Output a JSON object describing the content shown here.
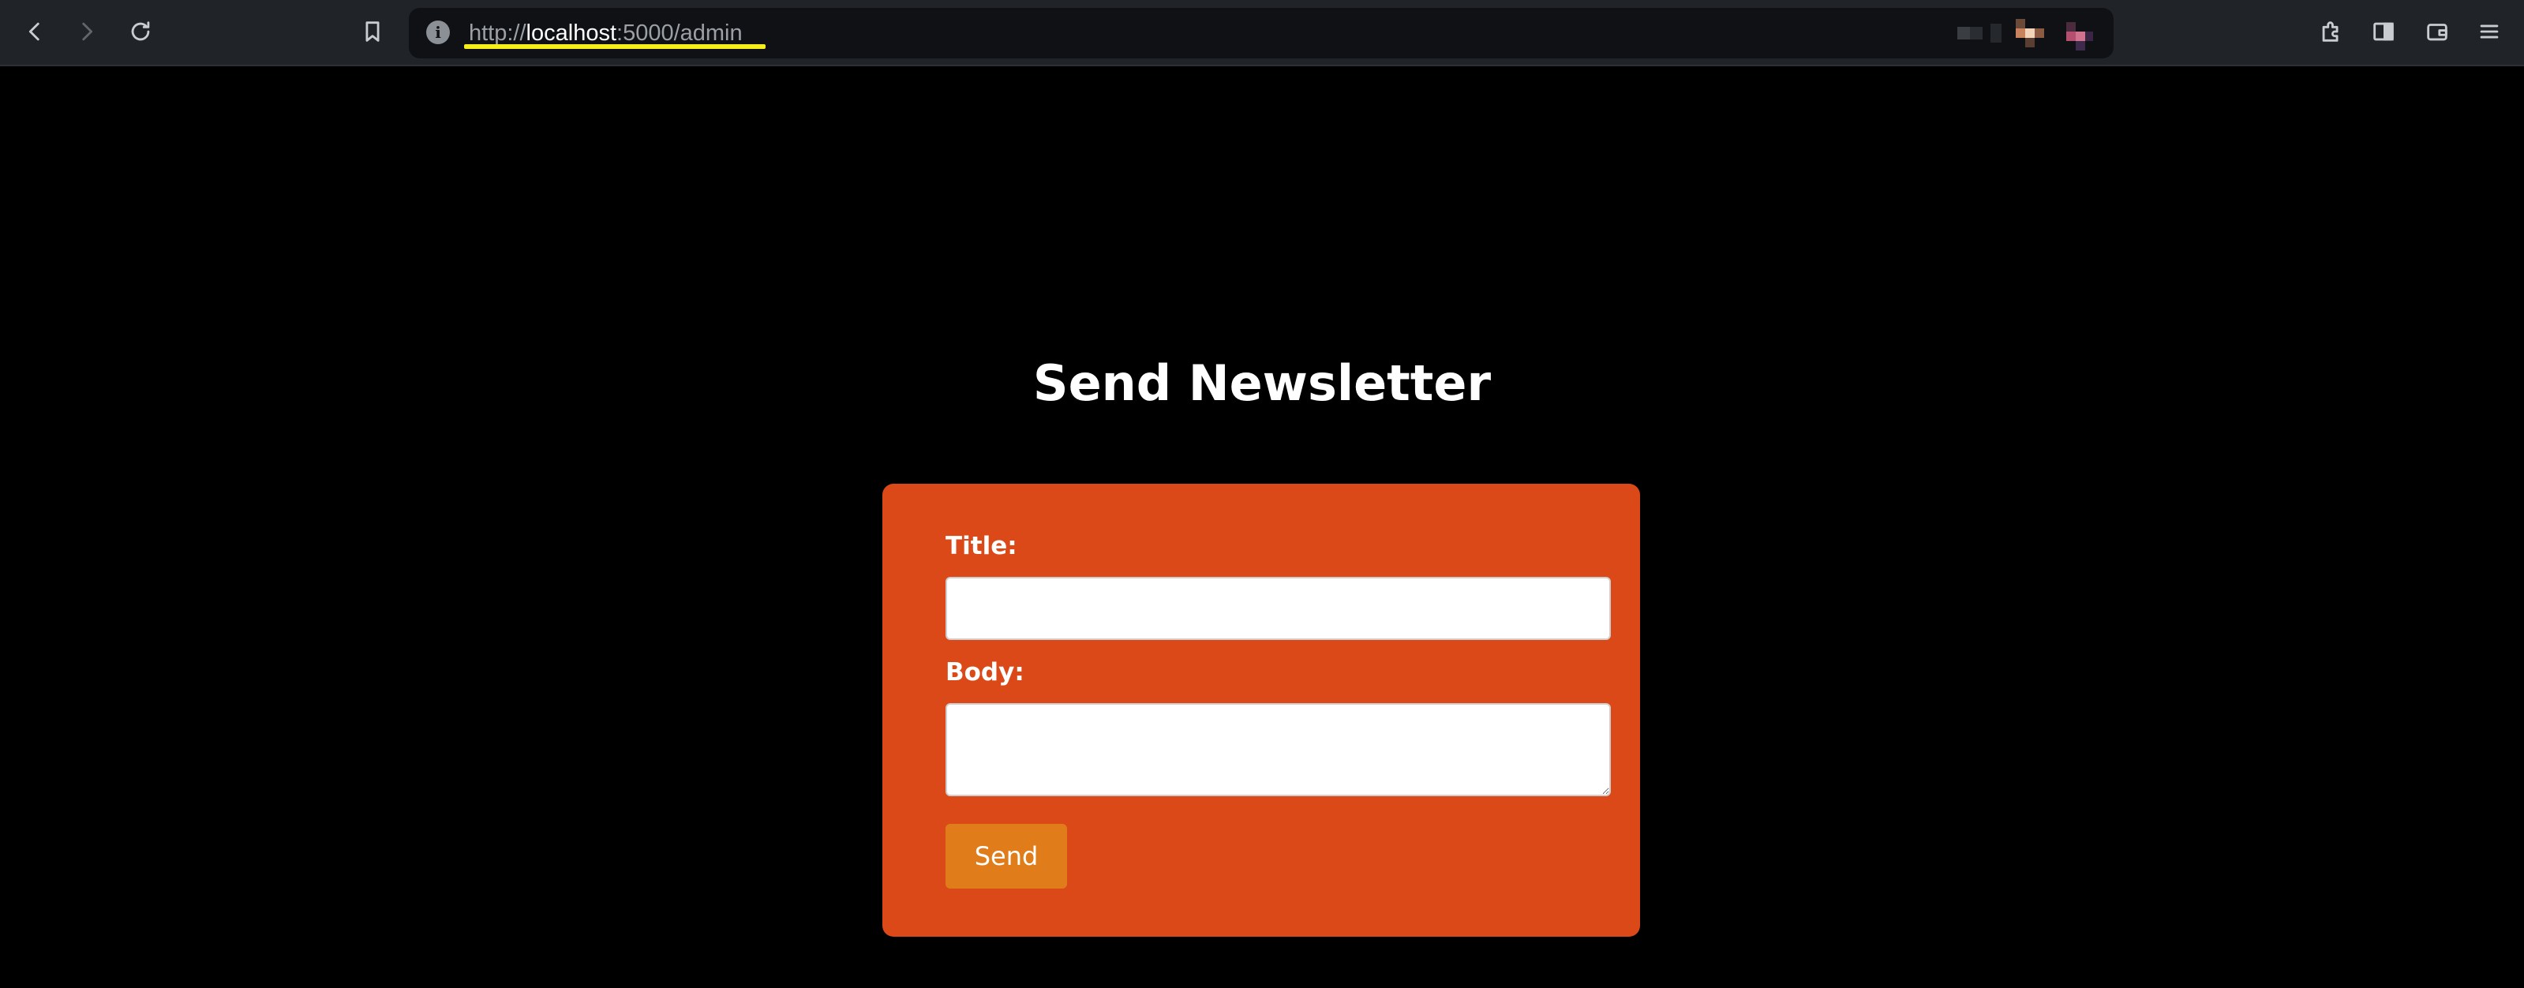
{
  "browser": {
    "url_scheme": "http://",
    "url_host": "localhost",
    "url_rest": ":5000/admin",
    "info_glyph": "i",
    "icons": {
      "back": "chevron-left-icon",
      "forward": "chevron-right-icon",
      "reload": "reload-icon",
      "bookmark": "bookmark-icon",
      "site_info": "info-icon",
      "extensions": "puzzle-icon",
      "sidebar": "sidebar-icon",
      "wallet": "wallet-icon",
      "menu": "hamburger-menu-icon"
    }
  },
  "page": {
    "heading": "Send Newsletter",
    "form": {
      "title_label": "Title:",
      "title_value": "",
      "body_label": "Body:",
      "body_value": "",
      "send_label": "Send"
    }
  },
  "colors": {
    "page_background": "#000000",
    "card_background": "#db4919",
    "button_background": "#e07d1a",
    "url_highlight": "#f5ee1a"
  }
}
